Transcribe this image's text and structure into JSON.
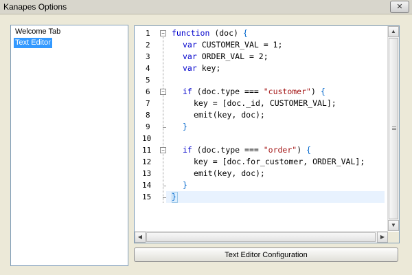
{
  "window": {
    "title": "Kanapes Options",
    "close_glyph": "✕"
  },
  "sidebar": {
    "items": [
      {
        "label": "Welcome Tab",
        "selected": false
      },
      {
        "label": "Text Editor",
        "selected": true
      }
    ]
  },
  "editor": {
    "line_numbers": [
      "1",
      "2",
      "3",
      "4",
      "5",
      "6",
      "7",
      "8",
      "9",
      "10",
      "11",
      "12",
      "13",
      "14",
      "15"
    ],
    "fold_markers": [
      "−",
      "−",
      "−"
    ],
    "code": {
      "l1_kw": "function",
      "l1_rest": " (doc) ",
      "l1_brace": "{",
      "l2": "var CUSTOMER_VAL = 1;",
      "l3": "var ORDER_VAL = 2;",
      "l4": "var key;",
      "l6_a": "if (doc.type === ",
      "l6_str": "\"customer\"",
      "l6_b": ") ",
      "l6_brace": "{",
      "l7": "key = [doc._id, CUSTOMER_VAL];",
      "l8": "emit(key, doc);",
      "l9": "}",
      "l11_a": "if (doc.type === ",
      "l11_str": "\"order\"",
      "l11_b": ") ",
      "l11_brace": "{",
      "l12": "key = [doc.for_customer, ORDER_VAL];",
      "l13": "emit(key, doc);",
      "l14": "}",
      "l15": "}"
    },
    "kw_var": "var",
    "kw_if": "if"
  },
  "buttons": {
    "config_label": "Text Editor Configuration"
  },
  "colors": {
    "selection": "#3399ff",
    "keyword": "#0000cc",
    "string": "#a31515"
  }
}
